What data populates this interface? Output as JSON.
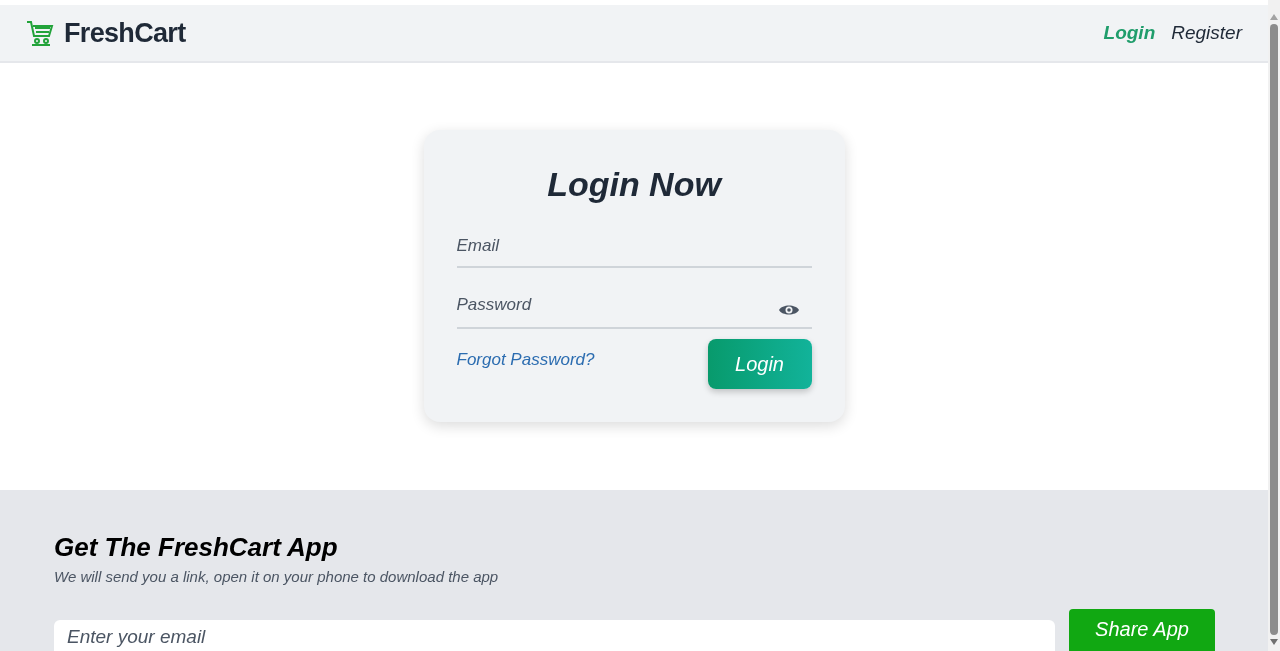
{
  "navbar": {
    "logo": "FreshCart",
    "links": [
      {
        "label": "Login",
        "selected": true
      },
      {
        "label": "Register",
        "selected": false
      }
    ]
  },
  "login_card": {
    "title": "Login Now",
    "fields": [
      {
        "kind": "email",
        "placeholder": "Email"
      },
      {
        "kind": "password",
        "placeholder": "Password"
      }
    ],
    "forgot_link": "Forgot Password?",
    "submit": "Login"
  },
  "app_section": {
    "title": "Get The FreshCart App",
    "subtitle": "We will send you a link, open it on your phone to download the app",
    "email_field": {
      "placeholder": "Enter your email"
    },
    "share_button": "Share App"
  }
}
